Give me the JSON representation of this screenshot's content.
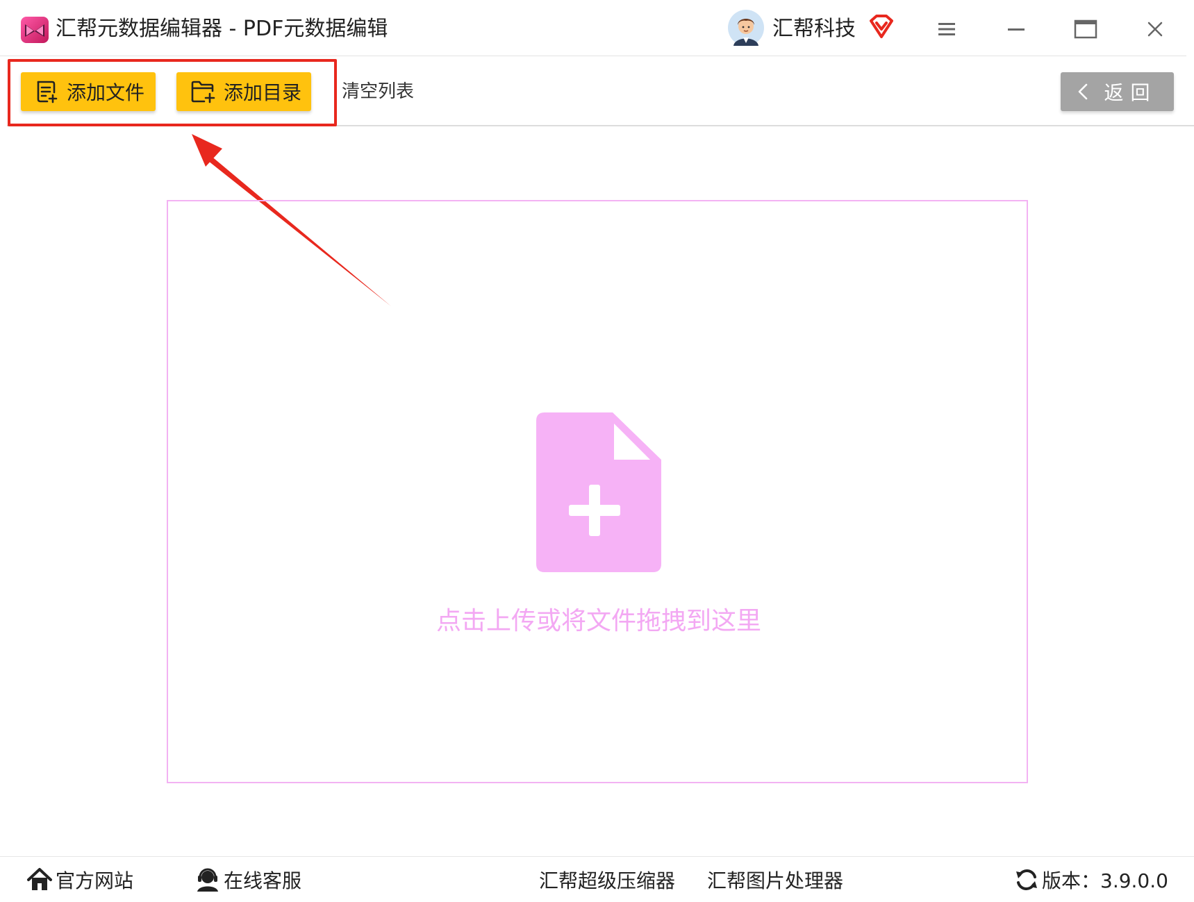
{
  "window": {
    "title": "汇帮元数据编辑器 - PDF元数据编辑",
    "user_name": "汇帮科技",
    "icons": {
      "logo": "app-logo-icon",
      "avatar": "user-avatar",
      "vip": "vip-diamond-icon",
      "menu": "hamburger-menu-icon",
      "minimize": "minimize-icon",
      "maximize": "maximize-icon",
      "close": "close-icon"
    }
  },
  "toolbar": {
    "add_file_label": "添加文件",
    "add_dir_label": "添加目录",
    "clear_label": "清空列表",
    "back_label": "返回",
    "accent_color": "#ffc20e",
    "back_color": "#a4a4a4"
  },
  "drop_zone": {
    "hint": "点击上传或将文件拖拽到这里",
    "icon": "file-plus-icon",
    "color": "#f3a8f3"
  },
  "annotation": {
    "color": "#e8281e"
  },
  "footer": {
    "site_label": "官方网站",
    "service_label": "在线客服",
    "compressor_label": "汇帮超级压缩器",
    "image_tool_label": "汇帮图片处理器",
    "version_label": "版本：3.9.0.0"
  }
}
